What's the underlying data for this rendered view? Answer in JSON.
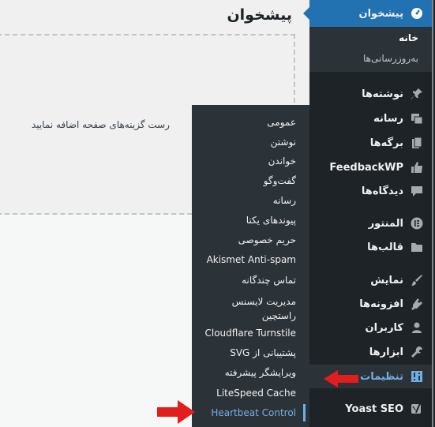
{
  "content": {
    "title": "پیشخوان",
    "empty_text": "رست گزینه‌های صفحه اضافه نمایید"
  },
  "menu": {
    "dashboard": {
      "label": "پیشخوان",
      "icon": "dashboard-icon",
      "submenu": {
        "home": "خانه",
        "updates": "به‌روزرسانی‌ها"
      }
    },
    "posts": {
      "label": "نوشته‌ها",
      "icon": "pin-icon"
    },
    "media": {
      "label": "رسانه",
      "icon": "media-icon"
    },
    "pages": {
      "label": "برگه‌ها",
      "icon": "pages-icon"
    },
    "feedbackwp": {
      "label": "FeedbackWP",
      "icon": "thumbs-up-icon"
    },
    "comments": {
      "label": "دیدگاه‌ها",
      "icon": "comment-icon"
    },
    "elementor": {
      "label": "المنتور",
      "icon": "elementor-icon"
    },
    "templates": {
      "label": "قالب‌ها",
      "icon": "folder-icon"
    },
    "appearance": {
      "label": "نمایش",
      "icon": "brush-icon"
    },
    "plugins": {
      "label": "افزونه‌ها",
      "icon": "plugin-icon"
    },
    "users": {
      "label": "کاربران",
      "icon": "user-icon"
    },
    "tools": {
      "label": "ابزارها",
      "icon": "wrench-icon"
    },
    "settings": {
      "label": "تنظیمات",
      "icon": "settings-icon"
    },
    "yoast": {
      "label": "Yoast SEO",
      "icon": "yoast-icon"
    }
  },
  "flyout": {
    "general": "عمومی",
    "writing": "نوشتن",
    "reading": "خواندن",
    "discussion": "گفت‌وگو",
    "media": "رسانه",
    "permalinks": "پیوندهای یکتا",
    "privacy": "حریم خصوصی",
    "akismet": "Akismet Anti-spam",
    "multi_contact": "تماس چندگانه",
    "rastchin_line1": "مدیریت لایسنس",
    "rastchin_line2": "راستچین",
    "turnstile": "Cloudflare Turnstile",
    "svg_support": "پشتیبانی از SVG",
    "advanced_editor": "ویرایشگر پیشرفته",
    "litespeed": "LiteSpeed Cache",
    "heartbeat": "Heartbeat Control"
  },
  "colors": {
    "menu_bg": "#1d2327",
    "submenu_bg": "#2c3338",
    "accent": "#2271b1",
    "active_text": "#72aee6",
    "arrow": "#e11d1d"
  }
}
